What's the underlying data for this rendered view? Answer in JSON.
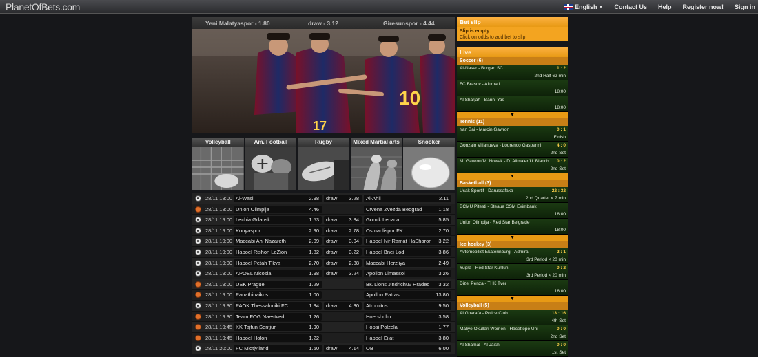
{
  "header": {
    "logo": "PlanetOfBets.com",
    "language": "English",
    "nav": [
      "Contact Us",
      "Help",
      "Register now!",
      "Sign in"
    ]
  },
  "hero": {
    "home": "Yeni Malatyaspor - 1.80",
    "draw": "draw - 3.12",
    "away": "Giresunspor - 4.44"
  },
  "sports": [
    {
      "label": "Volleyball",
      "icon": "volleyball-photo"
    },
    {
      "label": "Am. Football",
      "icon": "american-football-photo"
    },
    {
      "label": "Rugby",
      "icon": "rugby-ball-photo"
    },
    {
      "label": "Mixed Martial arts",
      "icon": "mma-photo"
    },
    {
      "label": "Snooker",
      "icon": "snooker-photo"
    }
  ],
  "matches": [
    {
      "sport": "soccer",
      "time": "28/11 18:00",
      "home": "Al-Wasl",
      "home_odd": "2.98",
      "draw": "draw",
      "draw_odd": "3.28",
      "away": "Al-Ahli",
      "away_odd": "2.11"
    },
    {
      "sport": "basketball",
      "time": "28/11 18:00",
      "home": "Union Olimpija",
      "home_odd": "4.46",
      "draw": "",
      "draw_odd": "",
      "away": "Crvena Zvezda Beograd",
      "away_odd": "1.18"
    },
    {
      "sport": "soccer",
      "time": "28/11 19:00",
      "home": "Lechia Gdansk",
      "home_odd": "1.53",
      "draw": "draw",
      "draw_odd": "3.84",
      "away": "Gornik Leczna",
      "away_odd": "5.85"
    },
    {
      "sport": "soccer",
      "time": "28/11 19:00",
      "home": "Konyaspor",
      "home_odd": "2.90",
      "draw": "draw",
      "draw_odd": "2.78",
      "away": "Osmanlispor FK",
      "away_odd": "2.70"
    },
    {
      "sport": "soccer",
      "time": "28/11 19:00",
      "home": "Maccabi Ahi Nazareth",
      "home_odd": "2.09",
      "draw": "draw",
      "draw_odd": "3.04",
      "away": "Hapoel Nir Ramat HaSharon",
      "away_odd": "3.22"
    },
    {
      "sport": "soccer",
      "time": "28/11 19:00",
      "home": "Hapoel Rishon LeZion",
      "home_odd": "1.82",
      "draw": "draw",
      "draw_odd": "3.22",
      "away": "Hapoel Bnei Lod",
      "away_odd": "3.86"
    },
    {
      "sport": "soccer",
      "time": "28/11 19:00",
      "home": "Hapoel Petah Tikva",
      "home_odd": "2.70",
      "draw": "draw",
      "draw_odd": "2.88",
      "away": "Maccabi Herzliya",
      "away_odd": "2.49"
    },
    {
      "sport": "soccer",
      "time": "28/11 19:00",
      "home": "APOEL Nicosia",
      "home_odd": "1.98",
      "draw": "draw",
      "draw_odd": "3.24",
      "away": "Apollon Limassol",
      "away_odd": "3.26"
    },
    {
      "sport": "basketball",
      "time": "28/11 19:00",
      "home": "USK Prague",
      "home_odd": "1.29",
      "draw": "",
      "draw_odd": "",
      "away": "BK Lions Jindrichuv Hradec",
      "away_odd": "3.32"
    },
    {
      "sport": "basketball",
      "time": "28/11 19:00",
      "home": "Panathinaikos",
      "home_odd": "1.00",
      "draw": "",
      "draw_odd": "",
      "away": "Apollon Patras",
      "away_odd": "13.80"
    },
    {
      "sport": "soccer",
      "time": "28/11 19:30",
      "home": "PAOK Thessaloniki FC",
      "home_odd": "1.34",
      "draw": "draw",
      "draw_odd": "4.30",
      "away": "Atromitos",
      "away_odd": "9.50"
    },
    {
      "sport": "basketball",
      "time": "28/11 19:30",
      "home": "Team FOG Naestved",
      "home_odd": "1.26",
      "draw": "",
      "draw_odd": "",
      "away": "Hoersholm",
      "away_odd": "3.58"
    },
    {
      "sport": "basketball",
      "time": "28/11 19:45",
      "home": "KK Tajfun Sentjur",
      "home_odd": "1.90",
      "draw": "",
      "draw_odd": "",
      "away": "Hopsi Polzela",
      "away_odd": "1.77"
    },
    {
      "sport": "basketball",
      "time": "28/11 19:45",
      "home": "Hapoel Holon",
      "home_odd": "1.22",
      "draw": "",
      "draw_odd": "",
      "away": "Hapoel Eilat",
      "away_odd": "3.80"
    },
    {
      "sport": "soccer",
      "time": "28/11 20:00",
      "home": "FC Midtjylland",
      "home_odd": "1.50",
      "draw": "draw",
      "draw_odd": "4.14",
      "away": "OB",
      "away_odd": "6.00"
    }
  ],
  "betslip": {
    "title": "Bet slip",
    "empty": "Slip is empty",
    "hint": "Click on odds to add bet to slip"
  },
  "live": {
    "title": "Live",
    "groups": [
      {
        "name": "Soccer (6)",
        "events": [
          {
            "name": "Al-Nasar - Burgan SC",
            "score": "1 : 2",
            "status": "2nd Half  62 min"
          },
          {
            "name": "FC Brasov - Afumati",
            "score": "",
            "status": "18:00"
          },
          {
            "name": "Al Sharjah - Banni Yas",
            "score": "",
            "status": "18:00"
          }
        ]
      },
      {
        "name": "Tennis (11)",
        "events": [
          {
            "name": "Yan Bai - Marcin Gawron",
            "score": "0 : 1",
            "status": "Finish"
          },
          {
            "name": "Gonzalo Villanueva - Lourenco Gasperini",
            "score": "4 : 0",
            "status": "2nd Set"
          },
          {
            "name": "M. Gawron/M. Nowak - D. Allmaier/U. Blanch",
            "score": "0 : 2",
            "status": "2nd Set"
          }
        ]
      },
      {
        "name": "Basketball (3)",
        "events": [
          {
            "name": "Usak Sportif - Darussafaka",
            "score": "22 : 32",
            "status": "2nd Quarter  < 7 min"
          },
          {
            "name": "BCMU Pitesti - Steaua CSM Eximbank",
            "score": "",
            "status": "18:00"
          },
          {
            "name": "Union Olimpija - Red Star Belgrade",
            "score": "",
            "status": "18:00"
          }
        ]
      },
      {
        "name": "Ice hockey (3)",
        "events": [
          {
            "name": "Avtomobilist Ekaterinburg - Admiral",
            "score": "2 : 1",
            "status": "3rd Period  < 20 min"
          },
          {
            "name": "Yugra - Red Star Kunlun",
            "score": "0 : 2",
            "status": "3rd Period  < 20 min"
          },
          {
            "name": "Dizel Penza - THK Tver",
            "score": "",
            "status": "18:00"
          }
        ]
      },
      {
        "name": "Volleyball (5)",
        "events": [
          {
            "name": "Al Gharafa - Police Club",
            "score": "13 : 16",
            "status": "4th Set"
          },
          {
            "name": "Maliye Okullari Women - Hacettepe Uni",
            "score": "0 : 0",
            "status": "2nd Set"
          },
          {
            "name": "Al Shamal - Al Jaish",
            "score": "0 : 0",
            "status": "1st Set"
          }
        ]
      }
    ]
  },
  "colors": {
    "accent": "#f3a420",
    "live_green": "#1b3a12",
    "score": "#ffd04a"
  }
}
